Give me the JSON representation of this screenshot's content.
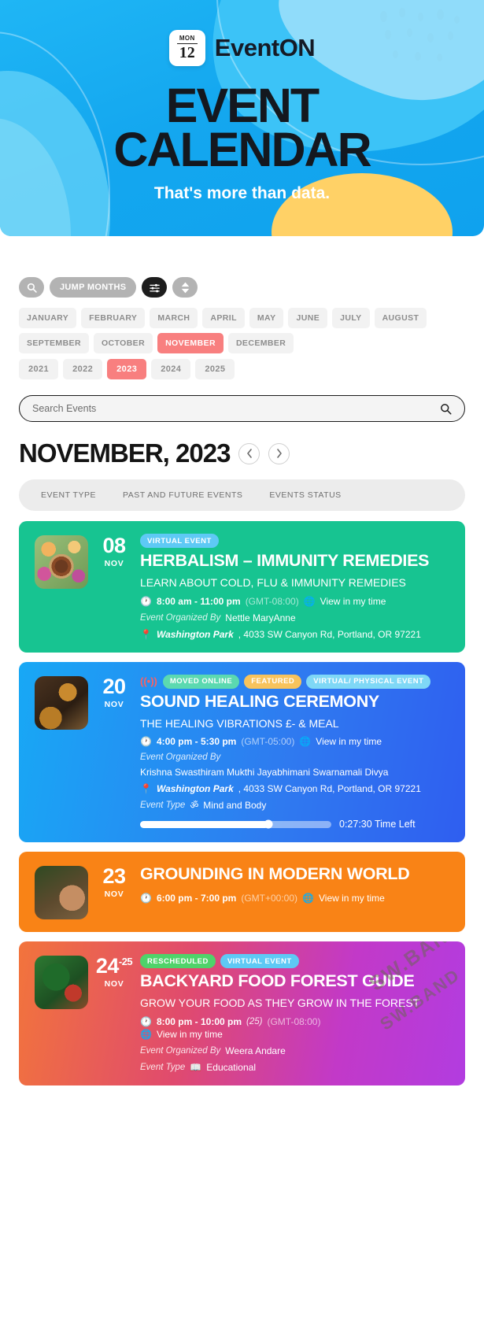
{
  "hero": {
    "logo_dow": "MON",
    "logo_day": "12",
    "brand": "EventON",
    "title_line1": "EVENT",
    "title_line2": "CALENDAR",
    "subtitle": "That's more than data."
  },
  "toolbar": {
    "search_icon": "search-icon",
    "jump_months_label": "JUMP MONTHS",
    "filter_icon": "sliders-icon",
    "sort_icon": "sort-updown-icon"
  },
  "months": [
    {
      "label": "JANUARY",
      "active": false
    },
    {
      "label": "FEBRUARY",
      "active": false
    },
    {
      "label": "MARCH",
      "active": false
    },
    {
      "label": "APRIL",
      "active": false
    },
    {
      "label": "MAY",
      "active": false
    },
    {
      "label": "JUNE",
      "active": false
    },
    {
      "label": "JULY",
      "active": false
    },
    {
      "label": "AUGUST",
      "active": false
    },
    {
      "label": "SEPTEMBER",
      "active": false
    },
    {
      "label": "OCTOBER",
      "active": false
    },
    {
      "label": "NOVEMBER",
      "active": true
    },
    {
      "label": "DECEMBER",
      "active": false
    }
  ],
  "years": [
    {
      "label": "2021",
      "active": false
    },
    {
      "label": "2022",
      "active": false
    },
    {
      "label": "2023",
      "active": true
    },
    {
      "label": "2024",
      "active": false
    },
    {
      "label": "2025",
      "active": false
    }
  ],
  "search": {
    "placeholder": "Search Events",
    "value": "",
    "icon": "search-icon"
  },
  "month_header": {
    "title": "NOVEMBER, 2023",
    "prev_icon": "chevron-left-icon",
    "next_icon": "chevron-right-icon"
  },
  "filters": [
    {
      "label": "EVENT TYPE"
    },
    {
      "label": "PAST AND FUTURE EVENTS"
    },
    {
      "label": "EVENTS STATUS"
    }
  ],
  "colors": {
    "accent_pink": "#f87f7f",
    "card_green": "#17c491",
    "card_blue": "#2f7af0",
    "card_orange": "#f98316",
    "card_purple": "#c239c8",
    "hero_blue": "#14a7ef"
  },
  "events": [
    {
      "day": "08",
      "day_end": "",
      "month": "NOV",
      "badges": [
        {
          "label": "VIRTUAL EVENT",
          "style": "b-virtual"
        }
      ],
      "live": false,
      "title": "HERBALISM – IMMUNITY REMEDIES",
      "subtitle": "LEARN ABOUT COLD, FLU & IMMUNITY REMEDIES",
      "time": "8:00 am - 11:00 pm",
      "timezone": "(GMT-08:00)",
      "view_time": "View in my time",
      "organizer_label": "Event Organized By",
      "organizers": "Nettle MaryAnne",
      "location_name": "Washington Park",
      "location_rest": ", 4033 SW Canyon Rd, Portland, OR 97221",
      "event_type_label": "",
      "event_type": "",
      "time_left": ""
    },
    {
      "day": "20",
      "day_end": "",
      "month": "NOV",
      "badges": [
        {
          "label": "MOVED ONLINE",
          "style": "b-moved"
        },
        {
          "label": "FEATURED",
          "style": "b-featured"
        },
        {
          "label": "VIRTUAL/ PHYSICAL EVENT",
          "style": "b-vp"
        }
      ],
      "live": true,
      "title": "SOUND HEALING CEREMONY",
      "subtitle": "THE HEALING VIBRATIONS £- & MEAL",
      "time": "4:00 pm - 5:30 pm",
      "timezone": "(GMT-05:00)",
      "view_time": "View in my time",
      "organizer_label": "Event Organized By",
      "organizers": "Krishna Swasthiram   Mukthi Jayabhimani Swarnamali Divya",
      "location_name": "Washington Park",
      "location_rest": ", 4033 SW Canyon Rd, Portland, OR 97221",
      "event_type_label": "Event Type",
      "event_type": "Mind and Body",
      "event_type_icon": "om-icon",
      "time_left": "0:27:30 Time Left",
      "progress_percent": 67
    },
    {
      "day": "23",
      "day_end": "",
      "month": "NOV",
      "badges": [],
      "live": false,
      "title": "GROUNDING IN MODERN WORLD",
      "subtitle": "",
      "time": "6:00 pm - 7:00 pm",
      "timezone": "(GMT+00:00)",
      "view_time": "View in my time",
      "organizer_label": "",
      "organizers": "",
      "location_name": "",
      "location_rest": "",
      "event_type_label": "",
      "event_type": "",
      "time_left": ""
    },
    {
      "day": "24",
      "day_end": "-25",
      "month": "NOV",
      "badges": [
        {
          "label": "RESCHEDULED",
          "style": "b-resched"
        },
        {
          "label": "VIRTUAL EVENT",
          "style": "b-virtual"
        }
      ],
      "live": false,
      "title": "BACKYARD FOOD FOREST GUIDE",
      "subtitle": "GROW YOUR FOOD AS THEY GROW IN THE FOREST",
      "time": "8:00 pm - 10:00 pm",
      "time_suffix": "(25)",
      "timezone": "(GMT-08:00)",
      "view_time": "View in my time",
      "organizer_label": "Event Organized By",
      "organizers": "Weera Andare",
      "location_name": "",
      "location_rest": "",
      "event_type_label": "Event Type",
      "event_type": "Educational",
      "event_type_icon": "book-icon",
      "time_left": ""
    }
  ],
  "watermark": {
    "line1": "SW.BAND",
    "line2": "SW.BAND"
  }
}
